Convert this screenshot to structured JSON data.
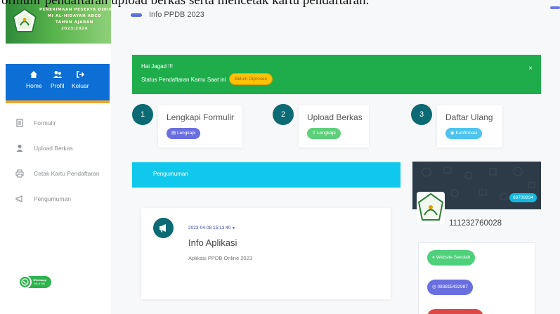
{
  "caption": "ormulir pendaftaran upload berkas serta mencetak kartu pendaftaran.",
  "logo": {
    "lines": [
      "PENERIMAAN PESERTA DIDIK BARU",
      "MI AL-HIDAYAH ABCD",
      "TAHUN AJARAN",
      "2023/2024"
    ]
  },
  "top_nav": {
    "home": "Home",
    "profile": "Profil",
    "logout": "Keluar"
  },
  "menu": [
    {
      "label": "Formulir",
      "icon": "form-icon"
    },
    {
      "label": "Upload Berkas",
      "icon": "upload-icon"
    },
    {
      "label": "Cetak Kartu Pendaftaran",
      "icon": "print-icon"
    },
    {
      "label": "Pengumuman",
      "icon": "megaphone-icon"
    }
  ],
  "whatsapp": {
    "line1": "Whatsapp",
    "line2": "Klik di Sini"
  },
  "page": {
    "title": "Info PPDB 2023"
  },
  "alert": {
    "greeting": "Hai Jagad !!!",
    "status_label": "Status Pendaftaran Kamu Saat ini",
    "status_value": "Belum Diproses",
    "close": "×"
  },
  "steps": [
    {
      "number": "1",
      "title": "Lengkapi Formulir",
      "button": "Lengkapi",
      "color": "#6a6fe0"
    },
    {
      "number": "2",
      "title": "Upload Berkas",
      "button": "Lengkapi",
      "color": "#5ed07b"
    },
    {
      "number": "3",
      "title": "Daftar Ulang",
      "button": "Konfirmasi",
      "color": "#4cc4ee"
    }
  ],
  "announcement": {
    "header": "Pengumuman",
    "date": "2023-04-08 15:13:40",
    "title": "Info Aplikasi",
    "description": "Aplikasi PPDB Online 2023"
  },
  "profile": {
    "badge": "60709934",
    "number": "111232760028",
    "links": [
      {
        "label": "Website Sekolah",
        "color": "#4fd07a"
      },
      {
        "label": "083815432987",
        "color": "#6a6fe0"
      },
      {
        "label": "",
        "color": "#e04848"
      }
    ]
  },
  "colors": {
    "nav_blue": "#0d6fd6",
    "alert_green": "#1fad4c",
    "info_cyan": "#10c8ec",
    "teal": "#0b6a73"
  }
}
